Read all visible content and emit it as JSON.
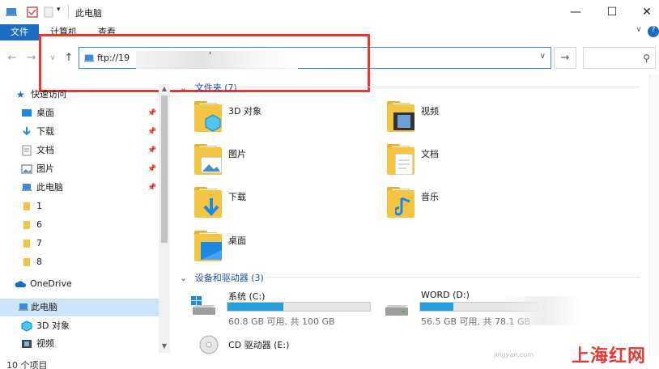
{
  "window": {
    "title": "此电脑"
  },
  "controls": {
    "minimize": "—",
    "maximize": "☐",
    "close": "✕",
    "chevron": "∨",
    "help": "?"
  },
  "ribbon": {
    "file": "文件",
    "tabs": [
      "计算机",
      "查看"
    ]
  },
  "address": {
    "text": "ftp://19",
    "tail": "'"
  },
  "nav": {
    "quick_access": "快速访问",
    "items": [
      {
        "label": "桌面",
        "pinned": true
      },
      {
        "label": "下载",
        "pinned": true
      },
      {
        "label": "文档",
        "pinned": true
      },
      {
        "label": "图片",
        "pinned": true
      },
      {
        "label": "此电脑",
        "pinned": true
      },
      {
        "label": "1"
      },
      {
        "label": "6"
      },
      {
        "label": "7"
      },
      {
        "label": "8"
      },
      {
        "label": "OneDrive"
      },
      {
        "label": "此电脑",
        "selected": true
      },
      {
        "label": "3D 对象"
      },
      {
        "label": "视频"
      }
    ]
  },
  "status": {
    "count": "10 个项目"
  },
  "groups": {
    "folders": "文件夹 (7)",
    "devices": "设备和驱动器 (3)"
  },
  "folders": [
    "3D 对象",
    "视频",
    "图片",
    "文档",
    "下载",
    "音乐",
    "桌面"
  ],
  "drives": [
    {
      "name": "系统 (C:)",
      "info": "60.8 GB 可用, 共 100 GB",
      "used_pct": 39
    },
    {
      "name": "WORD (D:)",
      "info": "56.5 GB 可用, 共 78.1 GB",
      "used_pct": 28
    },
    {
      "name": "CD 驱动器 (E:)"
    }
  ],
  "watermark": {
    "text": "上海红网",
    "sub": "jingyan.com"
  },
  "colors": {
    "accent": "#1e6cc2",
    "highlight": "#e53935",
    "drive_fill": "#26a0da",
    "folder": "#f4c542"
  }
}
